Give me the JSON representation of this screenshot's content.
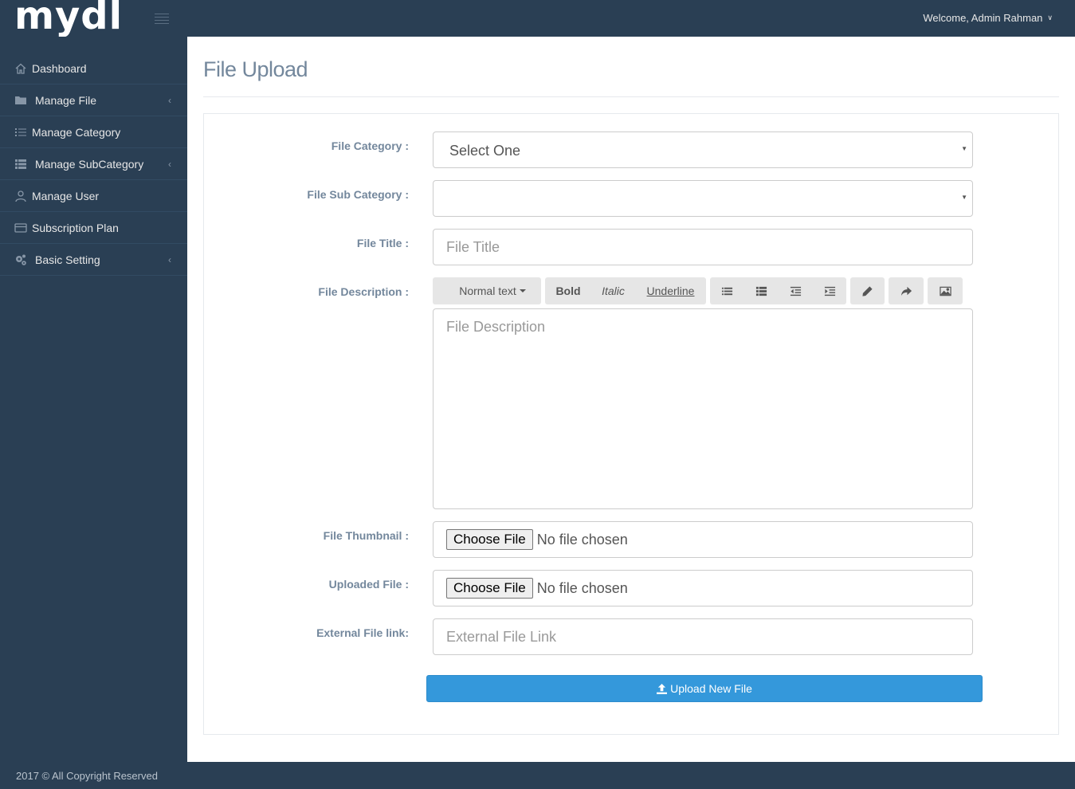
{
  "header": {
    "logo": "mydl",
    "welcome": "Welcome, Admin Rahman"
  },
  "sidebar": {
    "items": [
      {
        "label": "Dashboard",
        "icon": "home-icon",
        "has_caret": false
      },
      {
        "label": "Manage File",
        "icon": "folder-icon",
        "has_caret": true
      },
      {
        "label": "Manage Category",
        "icon": "list-icon",
        "has_caret": false
      },
      {
        "label": "Manage SubCategory",
        "icon": "th-list-icon",
        "has_caret": true
      },
      {
        "label": "Manage User",
        "icon": "user-icon",
        "has_caret": false
      },
      {
        "label": "Subscription Plan",
        "icon": "credit-card-icon",
        "has_caret": false
      },
      {
        "label": "Basic Setting",
        "icon": "cogs-icon",
        "has_caret": true
      }
    ]
  },
  "page": {
    "title": "File Upload"
  },
  "form": {
    "category_label": "File Category :",
    "category_value": "Select One",
    "subcategory_label": "File Sub Category :",
    "subcategory_value": "",
    "title_label": "File Title :",
    "title_placeholder": "File Title",
    "description_label": "File Description :",
    "description_placeholder": "File Description",
    "thumbnail_label": "File Thumbnail :",
    "uploaded_label": "Uploaded File :",
    "choose_file": "Choose File",
    "no_file": "No file chosen",
    "external_label": "External File link:",
    "external_placeholder": "External File Link",
    "submit_label": "Upload New File"
  },
  "editor_toolbar": {
    "format": "Normal text",
    "bold": "Bold",
    "italic": "Italic",
    "underline": "Underline"
  },
  "footer": {
    "text": "2017 © All Copyright Reserved"
  },
  "colors": {
    "sidebar_bg": "#2a3f54",
    "primary": "#3498db",
    "text": "#73879c"
  }
}
